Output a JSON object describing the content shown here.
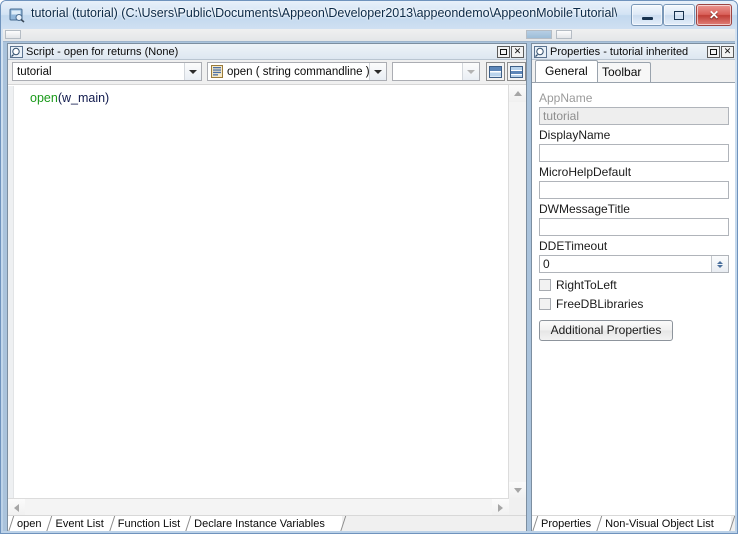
{
  "window": {
    "title": "tutorial (tutorial) (C:\\Users\\Public\\Documents\\Appeon\\Developer2013\\appeondemo\\AppeonMobileTutorial\\tu...",
    "icon": "application-icon",
    "controls": {
      "minimize": "minimize-button",
      "maximize": "maximize-button",
      "close": "close-button"
    },
    "colors": {
      "title_bar": "#d3e3f4",
      "mdi_background": "#aac3dc",
      "close_button": "#c03d36"
    }
  },
  "script_window": {
    "title": "Script - open for  returns (None)",
    "icon": "script-icon",
    "buttons": {
      "maximize": "maximize-button",
      "close": "close-button"
    },
    "toolbar": {
      "object_combo": {
        "value": "tutorial",
        "placeholder": ""
      },
      "event_combo": {
        "value": "open ( string commandline ) ret",
        "icon": "event-icon"
      },
      "third_combo": {
        "value": "",
        "placeholder": ""
      },
      "split_vertical_button": "split-pane-vertical-icon",
      "split_horizontal_button": "split-pane-horizontal-icon"
    },
    "code": {
      "keyword": "open",
      "rest": "(w_main)",
      "keyword_color": "#1a9a1a",
      "text_color": "#101a4d"
    },
    "tabs": [
      {
        "label": "open"
      },
      {
        "label": "Event List"
      },
      {
        "label": "Function List"
      },
      {
        "label": "Declare Instance Variables"
      }
    ]
  },
  "properties_window": {
    "title": "Properties - tutorial  inherited",
    "icon": "properties-icon",
    "buttons": {
      "maximize": "maximize-button",
      "close": "close-button"
    },
    "tabs": [
      {
        "label": "General"
      },
      {
        "label": "Toolbar"
      }
    ],
    "fields": {
      "appname": {
        "label": "AppName",
        "value": "tutorial"
      },
      "displayname": {
        "label": "DisplayName",
        "value": ""
      },
      "microhelpdefault": {
        "label": "MicroHelpDefault",
        "value": ""
      },
      "dwmessagetitle": {
        "label": "DWMessageTitle",
        "value": ""
      },
      "ddetimeout": {
        "label": "DDETimeout",
        "value": "0"
      },
      "righttoleft": {
        "label": "RightToLeft",
        "checked": false
      },
      "freedblibraries": {
        "label": "FreeDBLibraries",
        "checked": false
      }
    },
    "additional_properties_button": "Additional Properties",
    "bottom_tabs": [
      {
        "label": "Properties"
      },
      {
        "label": "Non-Visual Object List"
      }
    ]
  }
}
